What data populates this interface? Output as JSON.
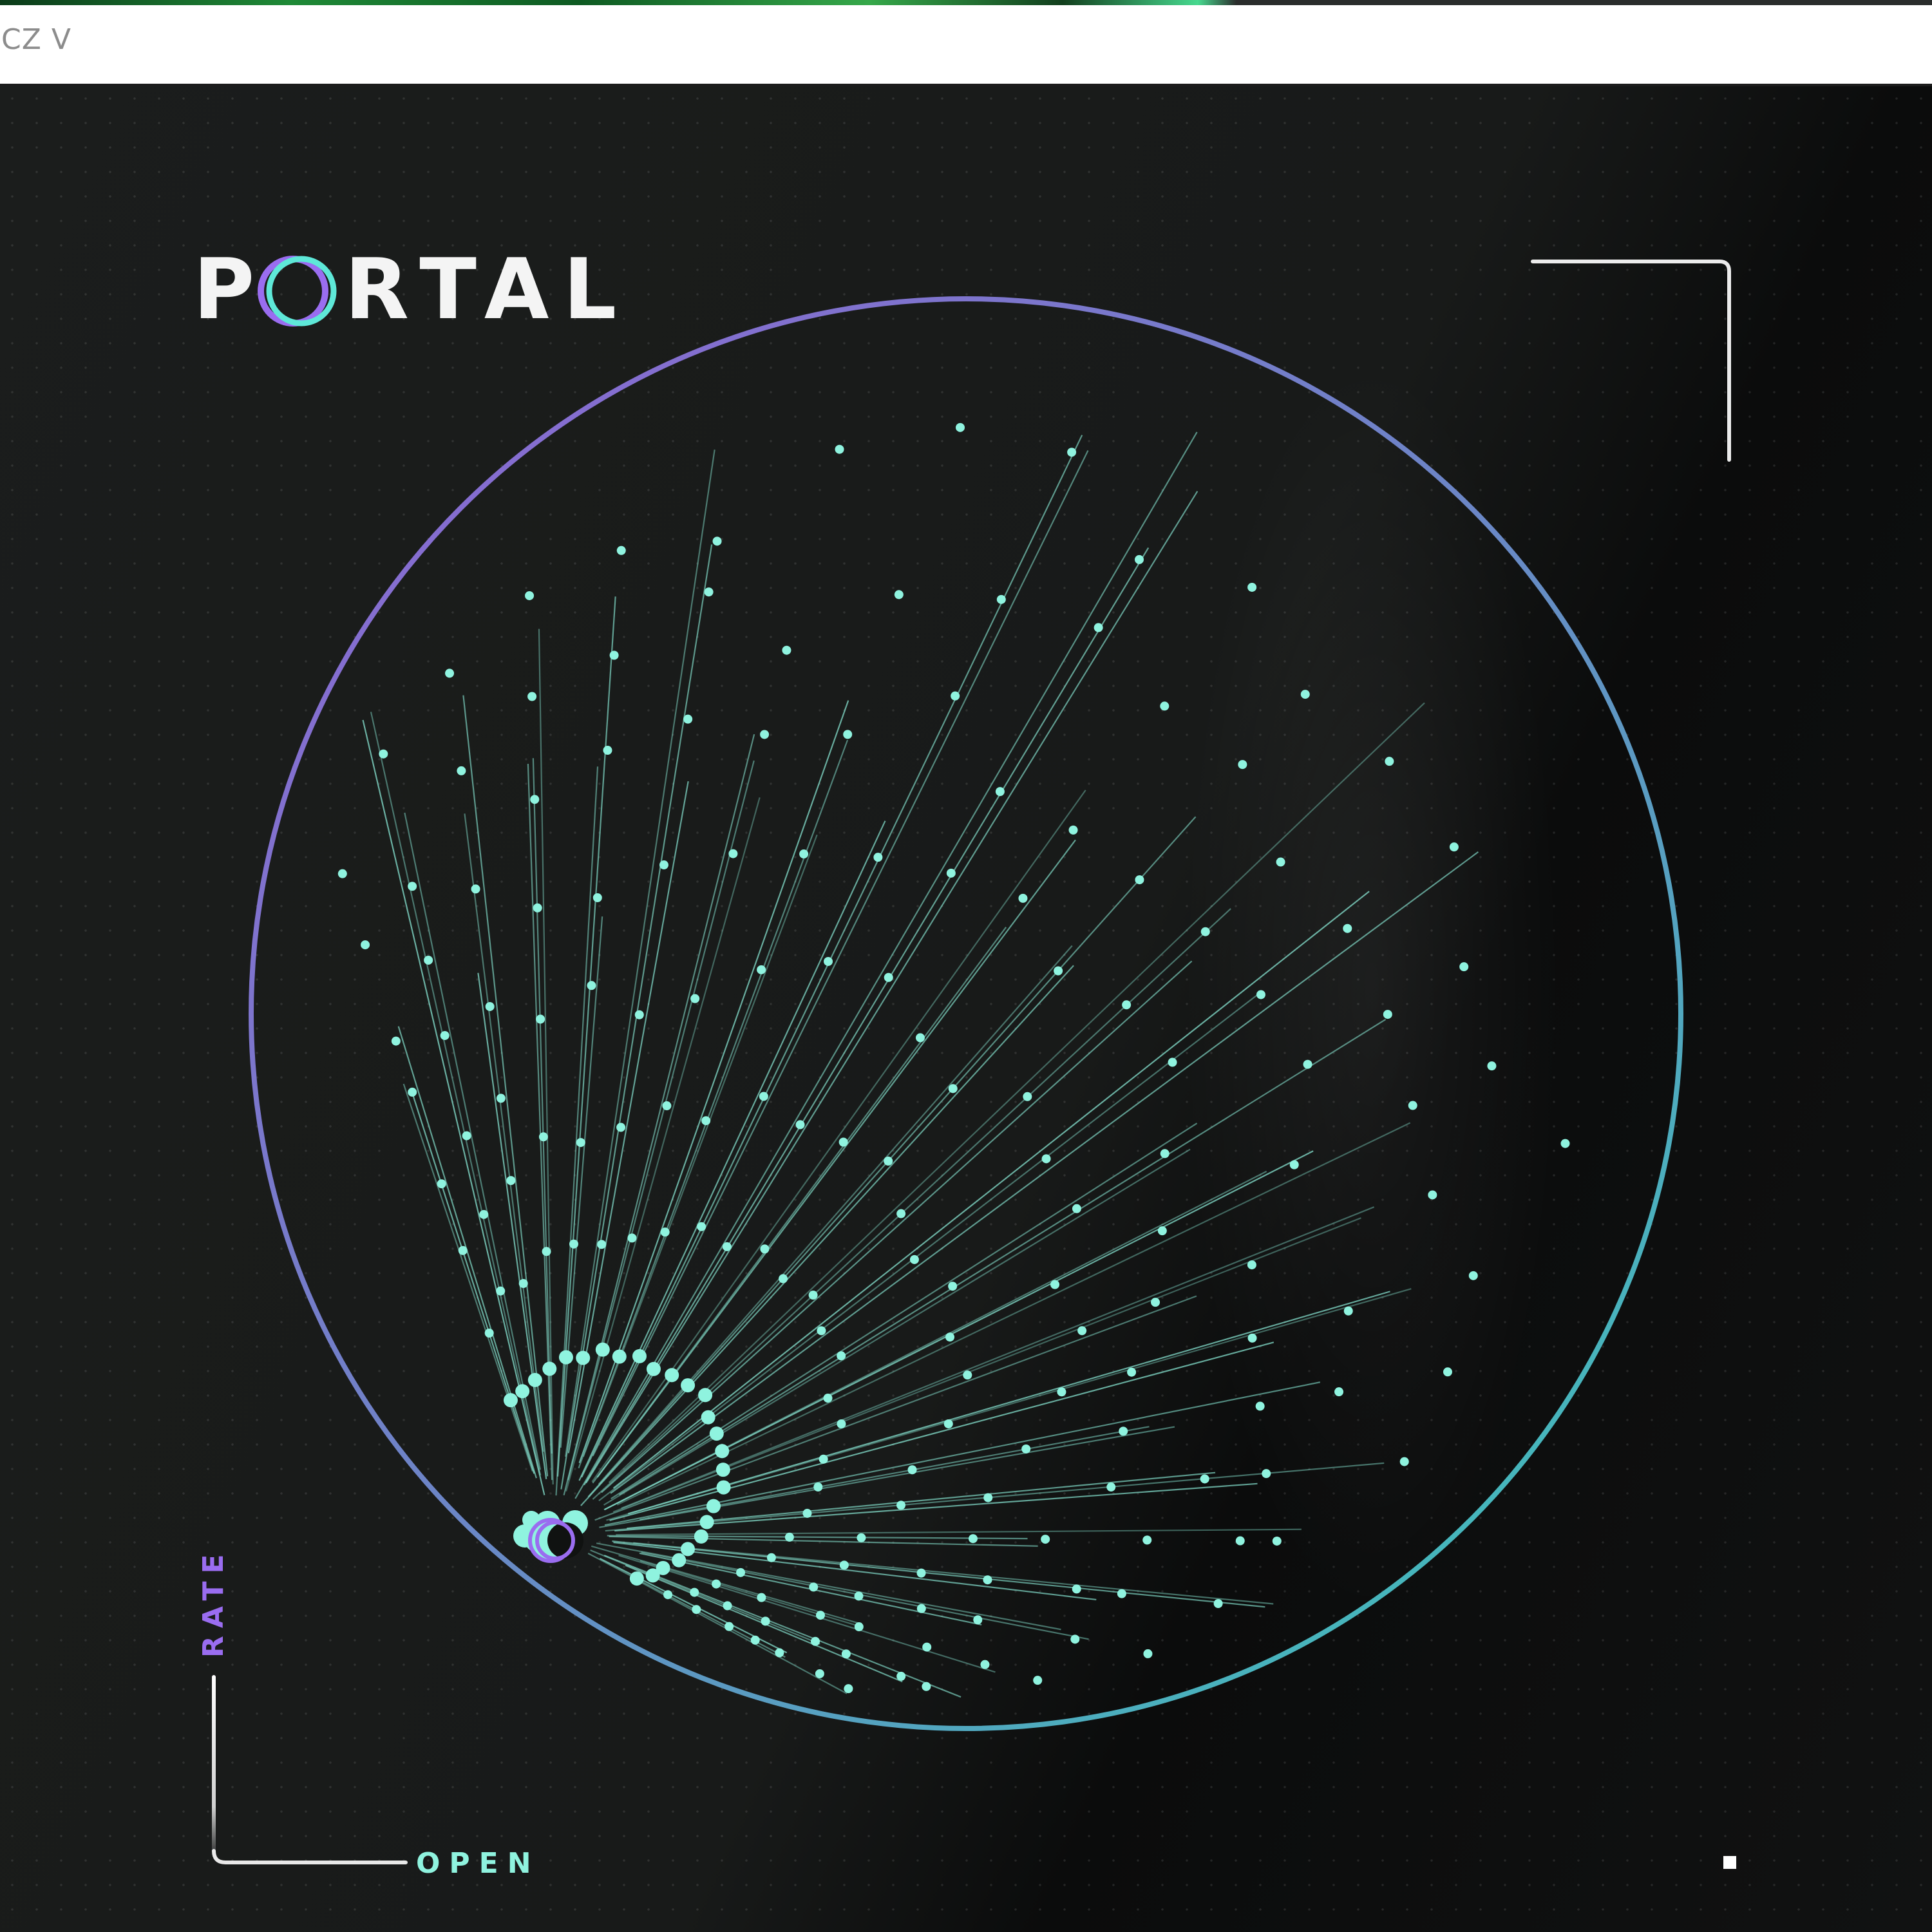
{
  "window": {
    "title": "CZ V"
  },
  "brand": {
    "logo_text_left": "P",
    "logo_text_right": "RTAL",
    "accent_purple": "#8c68d8",
    "accent_teal": "#3fc3be",
    "dot_color": "#8ff3df"
  },
  "controls": {
    "rate_label": "RATE",
    "open_label": "OPEN"
  }
}
